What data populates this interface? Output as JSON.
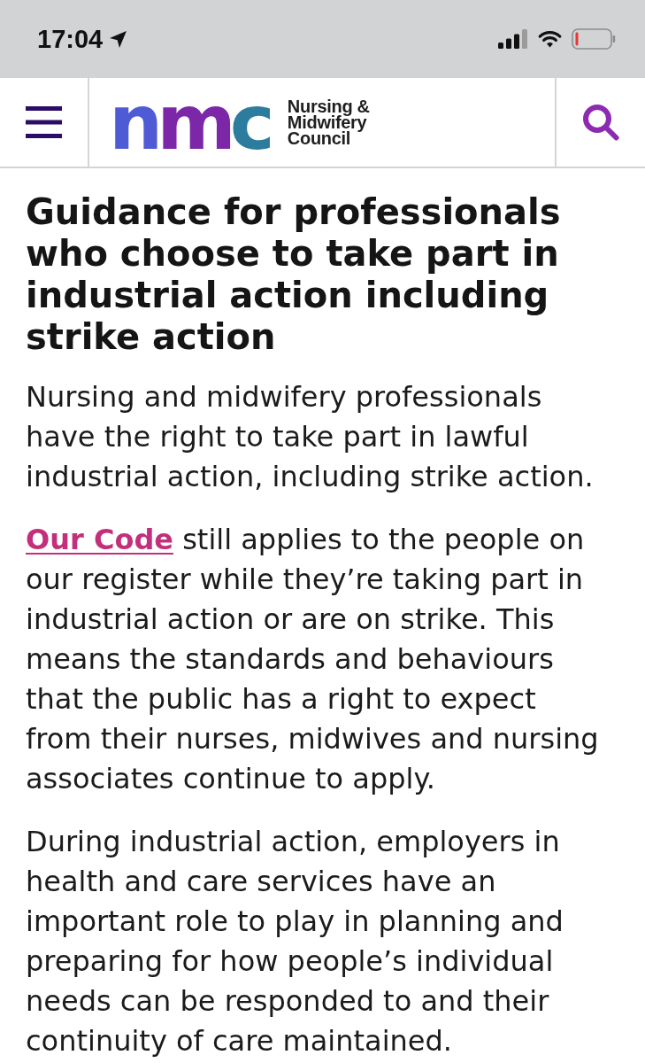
{
  "status_bar": {
    "time": "17:04"
  },
  "header": {
    "logo_mark": "nmc",
    "logo_wordmark": [
      "Nursing &",
      "Midwifery",
      "Council"
    ]
  },
  "article": {
    "title": "Guidance for professionals who choose to take part in industrial action including strike action",
    "paragraphs": [
      {
        "parts": [
          {
            "kind": "text",
            "text": "Nursing and midwifery professionals have the right to take part in lawful industrial action, including strike action."
          }
        ]
      },
      {
        "parts": [
          {
            "kind": "link",
            "text": "Our Code"
          },
          {
            "kind": "text",
            "text": " still applies to the people on our register while they’re taking part in industrial action or are on strike. This means the standards and behaviours that the public has a right to expect from their nurses, midwives and nursing associates continue to apply."
          }
        ]
      },
      {
        "parts": [
          {
            "kind": "text",
            "text": "During industrial action, employers in health and care services have an important role to play in planning and preparing for how people’s individual needs can be responded to and their continuity of care maintained."
          }
        ]
      }
    ]
  }
}
